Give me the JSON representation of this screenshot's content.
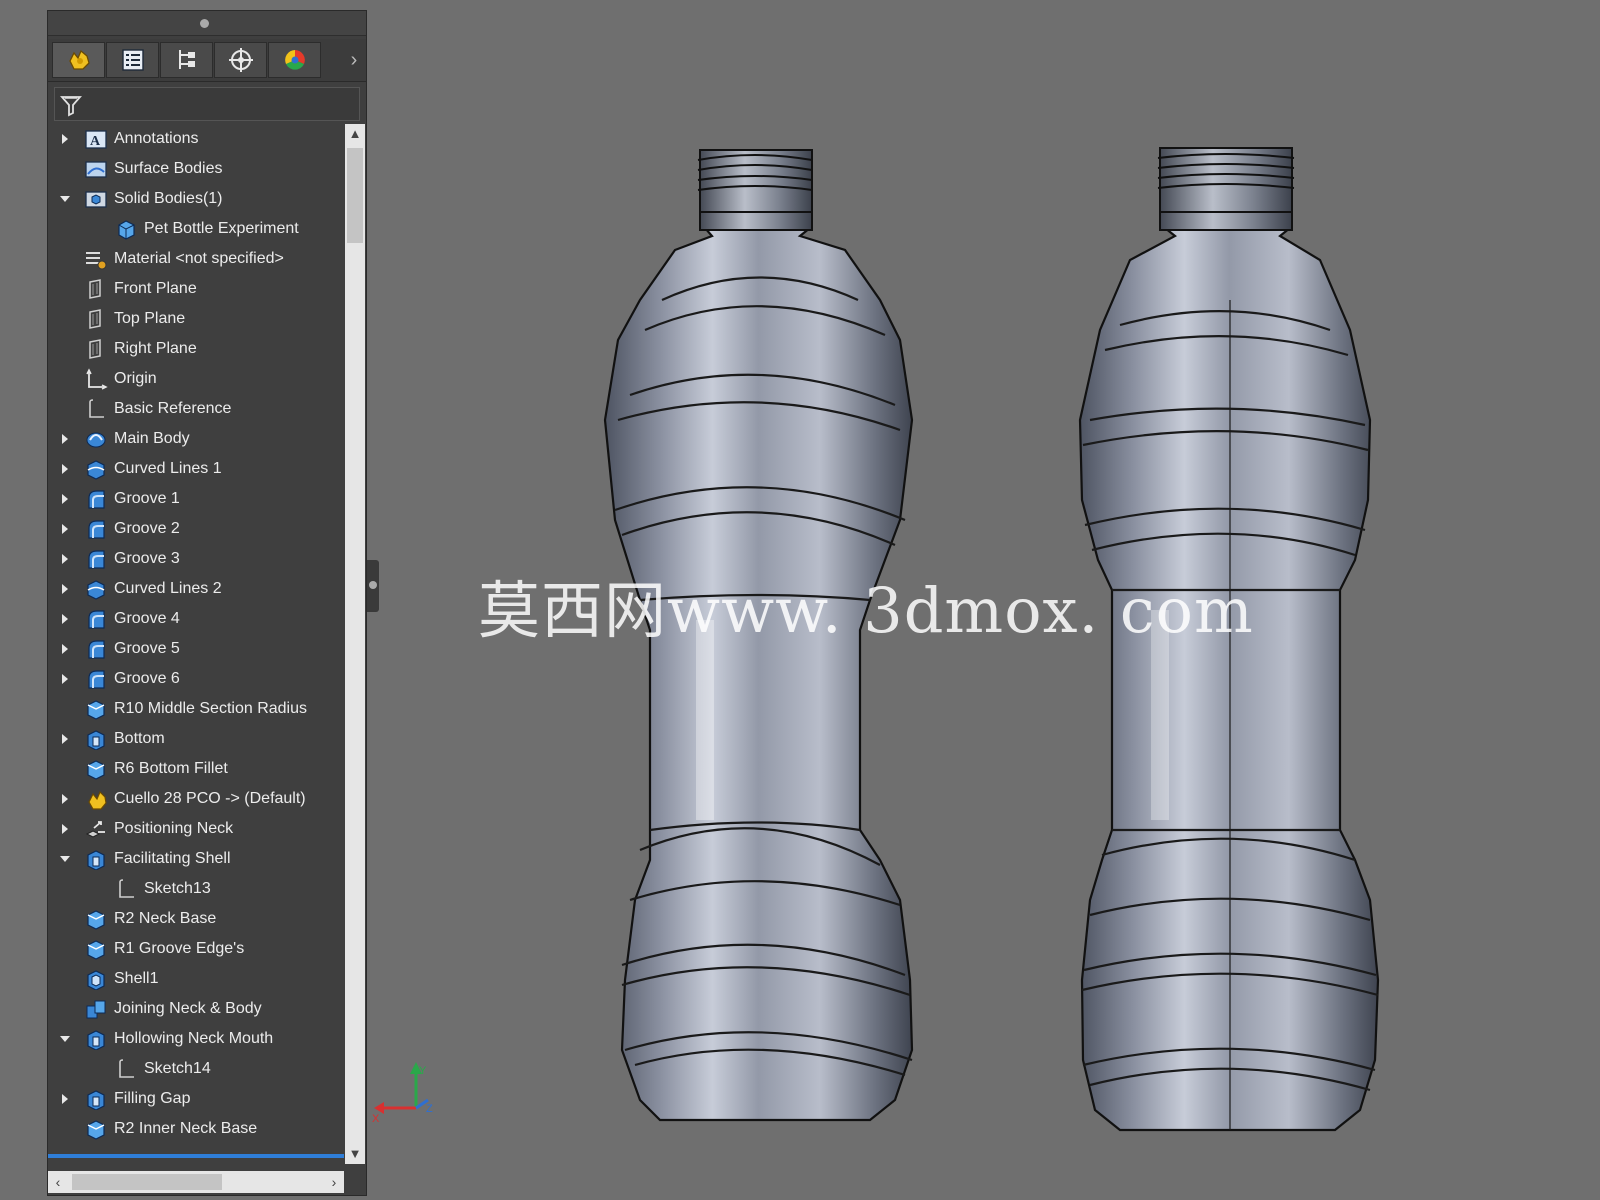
{
  "panel": {
    "tabs": [
      {
        "icon": "feature-manager-icon"
      },
      {
        "icon": "property-manager-icon"
      },
      {
        "icon": "configuration-manager-icon"
      },
      {
        "icon": "dimxpert-manager-icon"
      },
      {
        "icon": "display-manager-icon"
      }
    ],
    "filter_icon": "filter-icon",
    "tree": [
      {
        "label": "Annotations",
        "icon": "annotations-icon",
        "expander": "collapsed",
        "indent": 0
      },
      {
        "label": "Surface Bodies",
        "icon": "surface-bodies-icon",
        "expander": "none",
        "indent": 0
      },
      {
        "label": "Solid Bodies(1)",
        "icon": "solid-bodies-icon",
        "expander": "expanded",
        "indent": 0
      },
      {
        "label": "Pet Bottle Experiment",
        "icon": "solid-body-icon",
        "expander": "none",
        "indent": 1
      },
      {
        "label": "Material <not specified>",
        "icon": "material-icon",
        "expander": "none",
        "indent": 0
      },
      {
        "label": "Front Plane",
        "icon": "plane-icon",
        "expander": "none",
        "indent": 0
      },
      {
        "label": "Top Plane",
        "icon": "plane-icon",
        "expander": "none",
        "indent": 0
      },
      {
        "label": "Right Plane",
        "icon": "plane-icon",
        "expander": "none",
        "indent": 0
      },
      {
        "label": "Origin",
        "icon": "origin-icon",
        "expander": "none",
        "indent": 0
      },
      {
        "label": "Basic Reference",
        "icon": "sketch-icon",
        "expander": "none",
        "indent": 0
      },
      {
        "label": "Main Body",
        "icon": "revolve-icon",
        "expander": "collapsed",
        "indent": 0
      },
      {
        "label": "Curved Lines 1",
        "icon": "split-line-icon",
        "expander": "collapsed",
        "indent": 0
      },
      {
        "label": "Groove 1",
        "icon": "groove-icon",
        "expander": "collapsed",
        "indent": 0
      },
      {
        "label": "Groove 2",
        "icon": "groove-icon",
        "expander": "collapsed",
        "indent": 0
      },
      {
        "label": "Groove 3",
        "icon": "groove-icon",
        "expander": "collapsed",
        "indent": 0
      },
      {
        "label": "Curved Lines 2",
        "icon": "split-line-icon",
        "expander": "collapsed",
        "indent": 0
      },
      {
        "label": "Groove 4",
        "icon": "groove-icon",
        "expander": "collapsed",
        "indent": 0
      },
      {
        "label": "Groove 5",
        "icon": "groove-icon",
        "expander": "collapsed",
        "indent": 0
      },
      {
        "label": "Groove 6",
        "icon": "groove-icon",
        "expander": "collapsed",
        "indent": 0
      },
      {
        "label": "R10 Middle Section Radius",
        "icon": "fillet-icon",
        "expander": "none",
        "indent": 0
      },
      {
        "label": "Bottom",
        "icon": "extrude-cut-icon",
        "expander": "collapsed",
        "indent": 0
      },
      {
        "label": "R6 Bottom Fillet",
        "icon": "fillet-icon",
        "expander": "none",
        "indent": 0
      },
      {
        "label": "Cuello 28 PCO -> (Default)",
        "icon": "derived-part-icon",
        "expander": "collapsed",
        "indent": 0
      },
      {
        "label": "Positioning Neck",
        "icon": "move-body-icon",
        "expander": "collapsed",
        "indent": 0
      },
      {
        "label": "Facilitating Shell",
        "icon": "extrude-cut-icon",
        "expander": "expanded",
        "indent": 0
      },
      {
        "label": "Sketch13",
        "icon": "sketch-icon",
        "expander": "none",
        "indent": 1
      },
      {
        "label": "R2 Neck Base",
        "icon": "fillet-icon",
        "expander": "none",
        "indent": 0
      },
      {
        "label": "R1 Groove Edge's",
        "icon": "fillet-icon",
        "expander": "none",
        "indent": 0
      },
      {
        "label": "Shell1",
        "icon": "shell-icon",
        "expander": "none",
        "indent": 0
      },
      {
        "label": "Joining Neck & Body",
        "icon": "combine-icon",
        "expander": "none",
        "indent": 0
      },
      {
        "label": "Hollowing Neck Mouth",
        "icon": "extrude-cut-icon",
        "expander": "expanded",
        "indent": 0
      },
      {
        "label": "Sketch14",
        "icon": "sketch-icon",
        "expander": "none",
        "indent": 1
      },
      {
        "label": "Filling Gap",
        "icon": "extrude-cut-icon",
        "expander": "collapsed",
        "indent": 0
      },
      {
        "label": "R2 Inner Neck Base",
        "icon": "fillet-icon",
        "expander": "none",
        "indent": 0
      }
    ]
  },
  "viewport": {
    "watermark": "莫西网www. 3dmox. com",
    "triad": {
      "x_label": "X",
      "y_label": "Y",
      "z_label": "Z"
    }
  },
  "colors": {
    "panel_bg": "#3f3f3f",
    "viewport_bg": "#6f6f6f",
    "selection_bar": "#2f7ed8"
  }
}
